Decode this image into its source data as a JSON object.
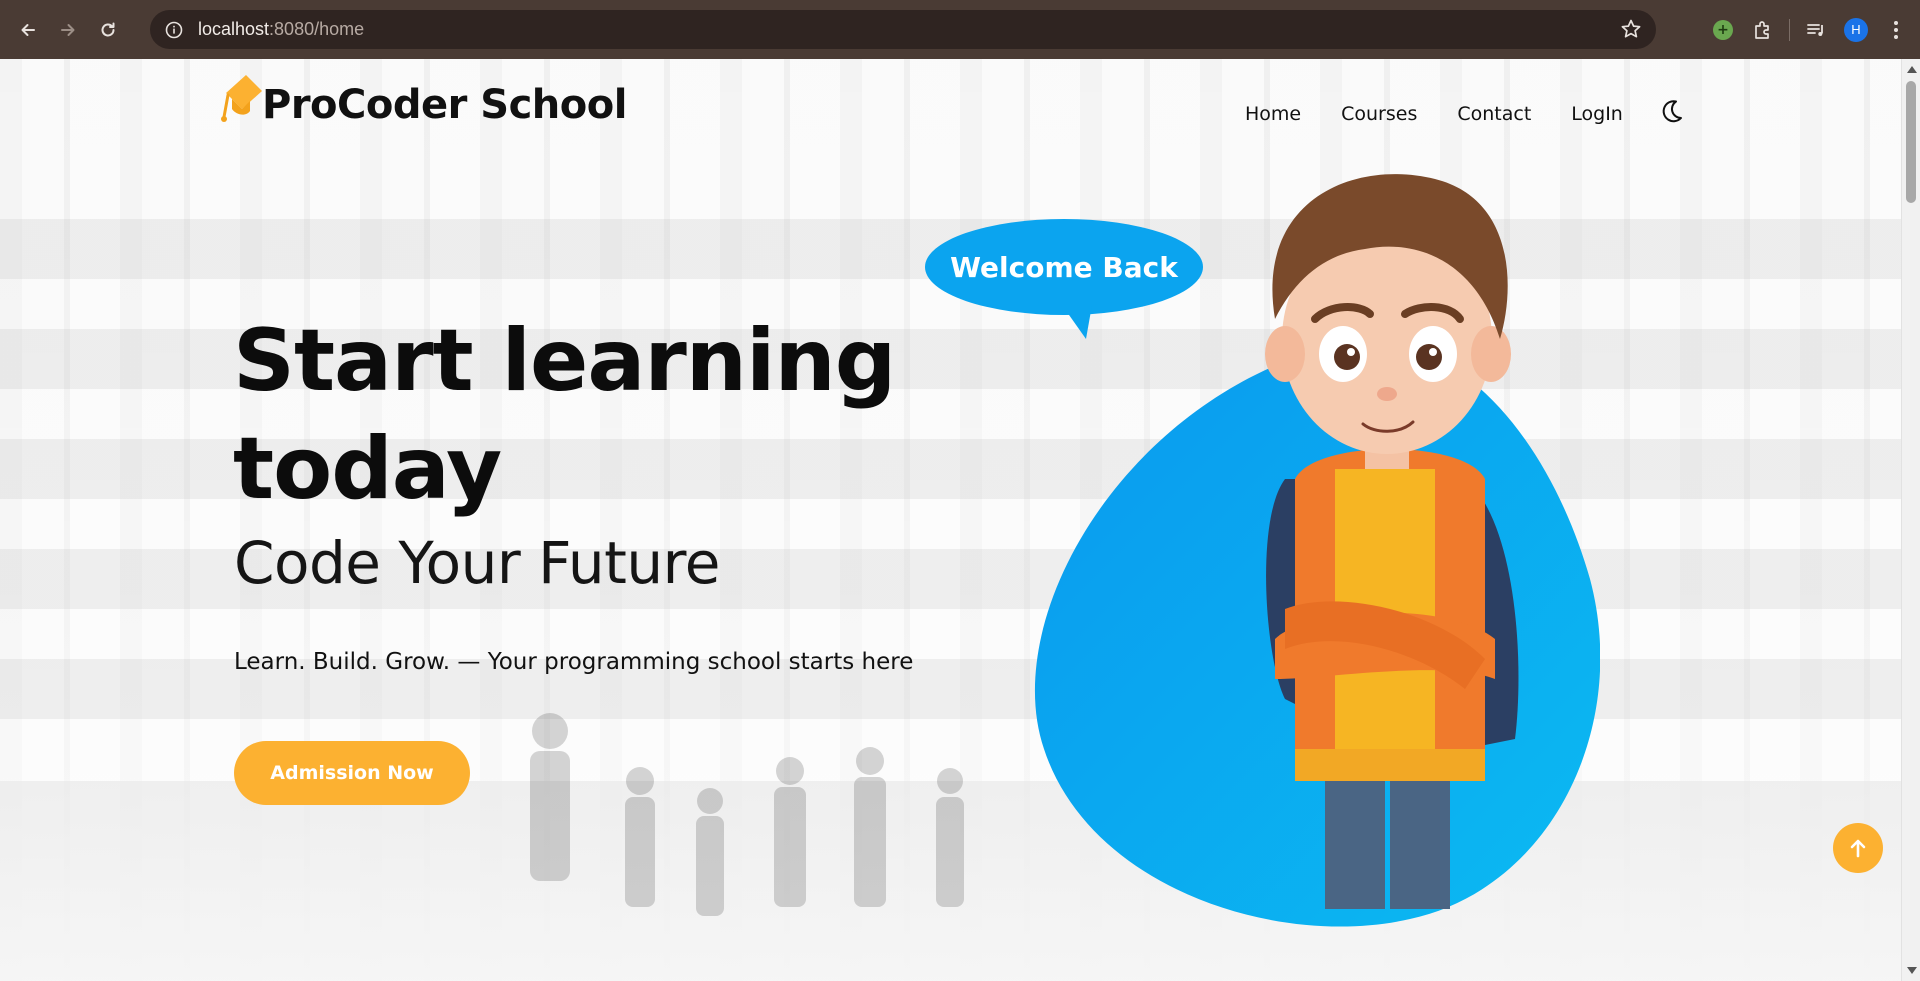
{
  "browser": {
    "url_host": "localhost",
    "url_path": ":8080/home",
    "profile_initial": "H"
  },
  "site": {
    "brand": "ProCoder School",
    "nav": [
      "Home",
      "Courses",
      "Contact",
      "LogIn"
    ]
  },
  "hero": {
    "title_line1": "Start learning",
    "title_line2": "today",
    "subtitle": "Code Your Future",
    "tagline": "Learn. Build. Grow. — Your programming school starts here",
    "cta_label": "Admission Now",
    "bubble_text": "Welcome Back"
  },
  "colors": {
    "accent": "#fcb131",
    "blob": "#0ba4ef",
    "chrome": "#4a3b34"
  },
  "icons": [
    "back-icon",
    "forward-icon",
    "reload-icon",
    "info-icon",
    "star-icon",
    "extension-icon",
    "puzzle-icon",
    "media-icon",
    "menu-icon",
    "graduation-cap-icon",
    "moon-icon",
    "arrow-up-icon"
  ]
}
